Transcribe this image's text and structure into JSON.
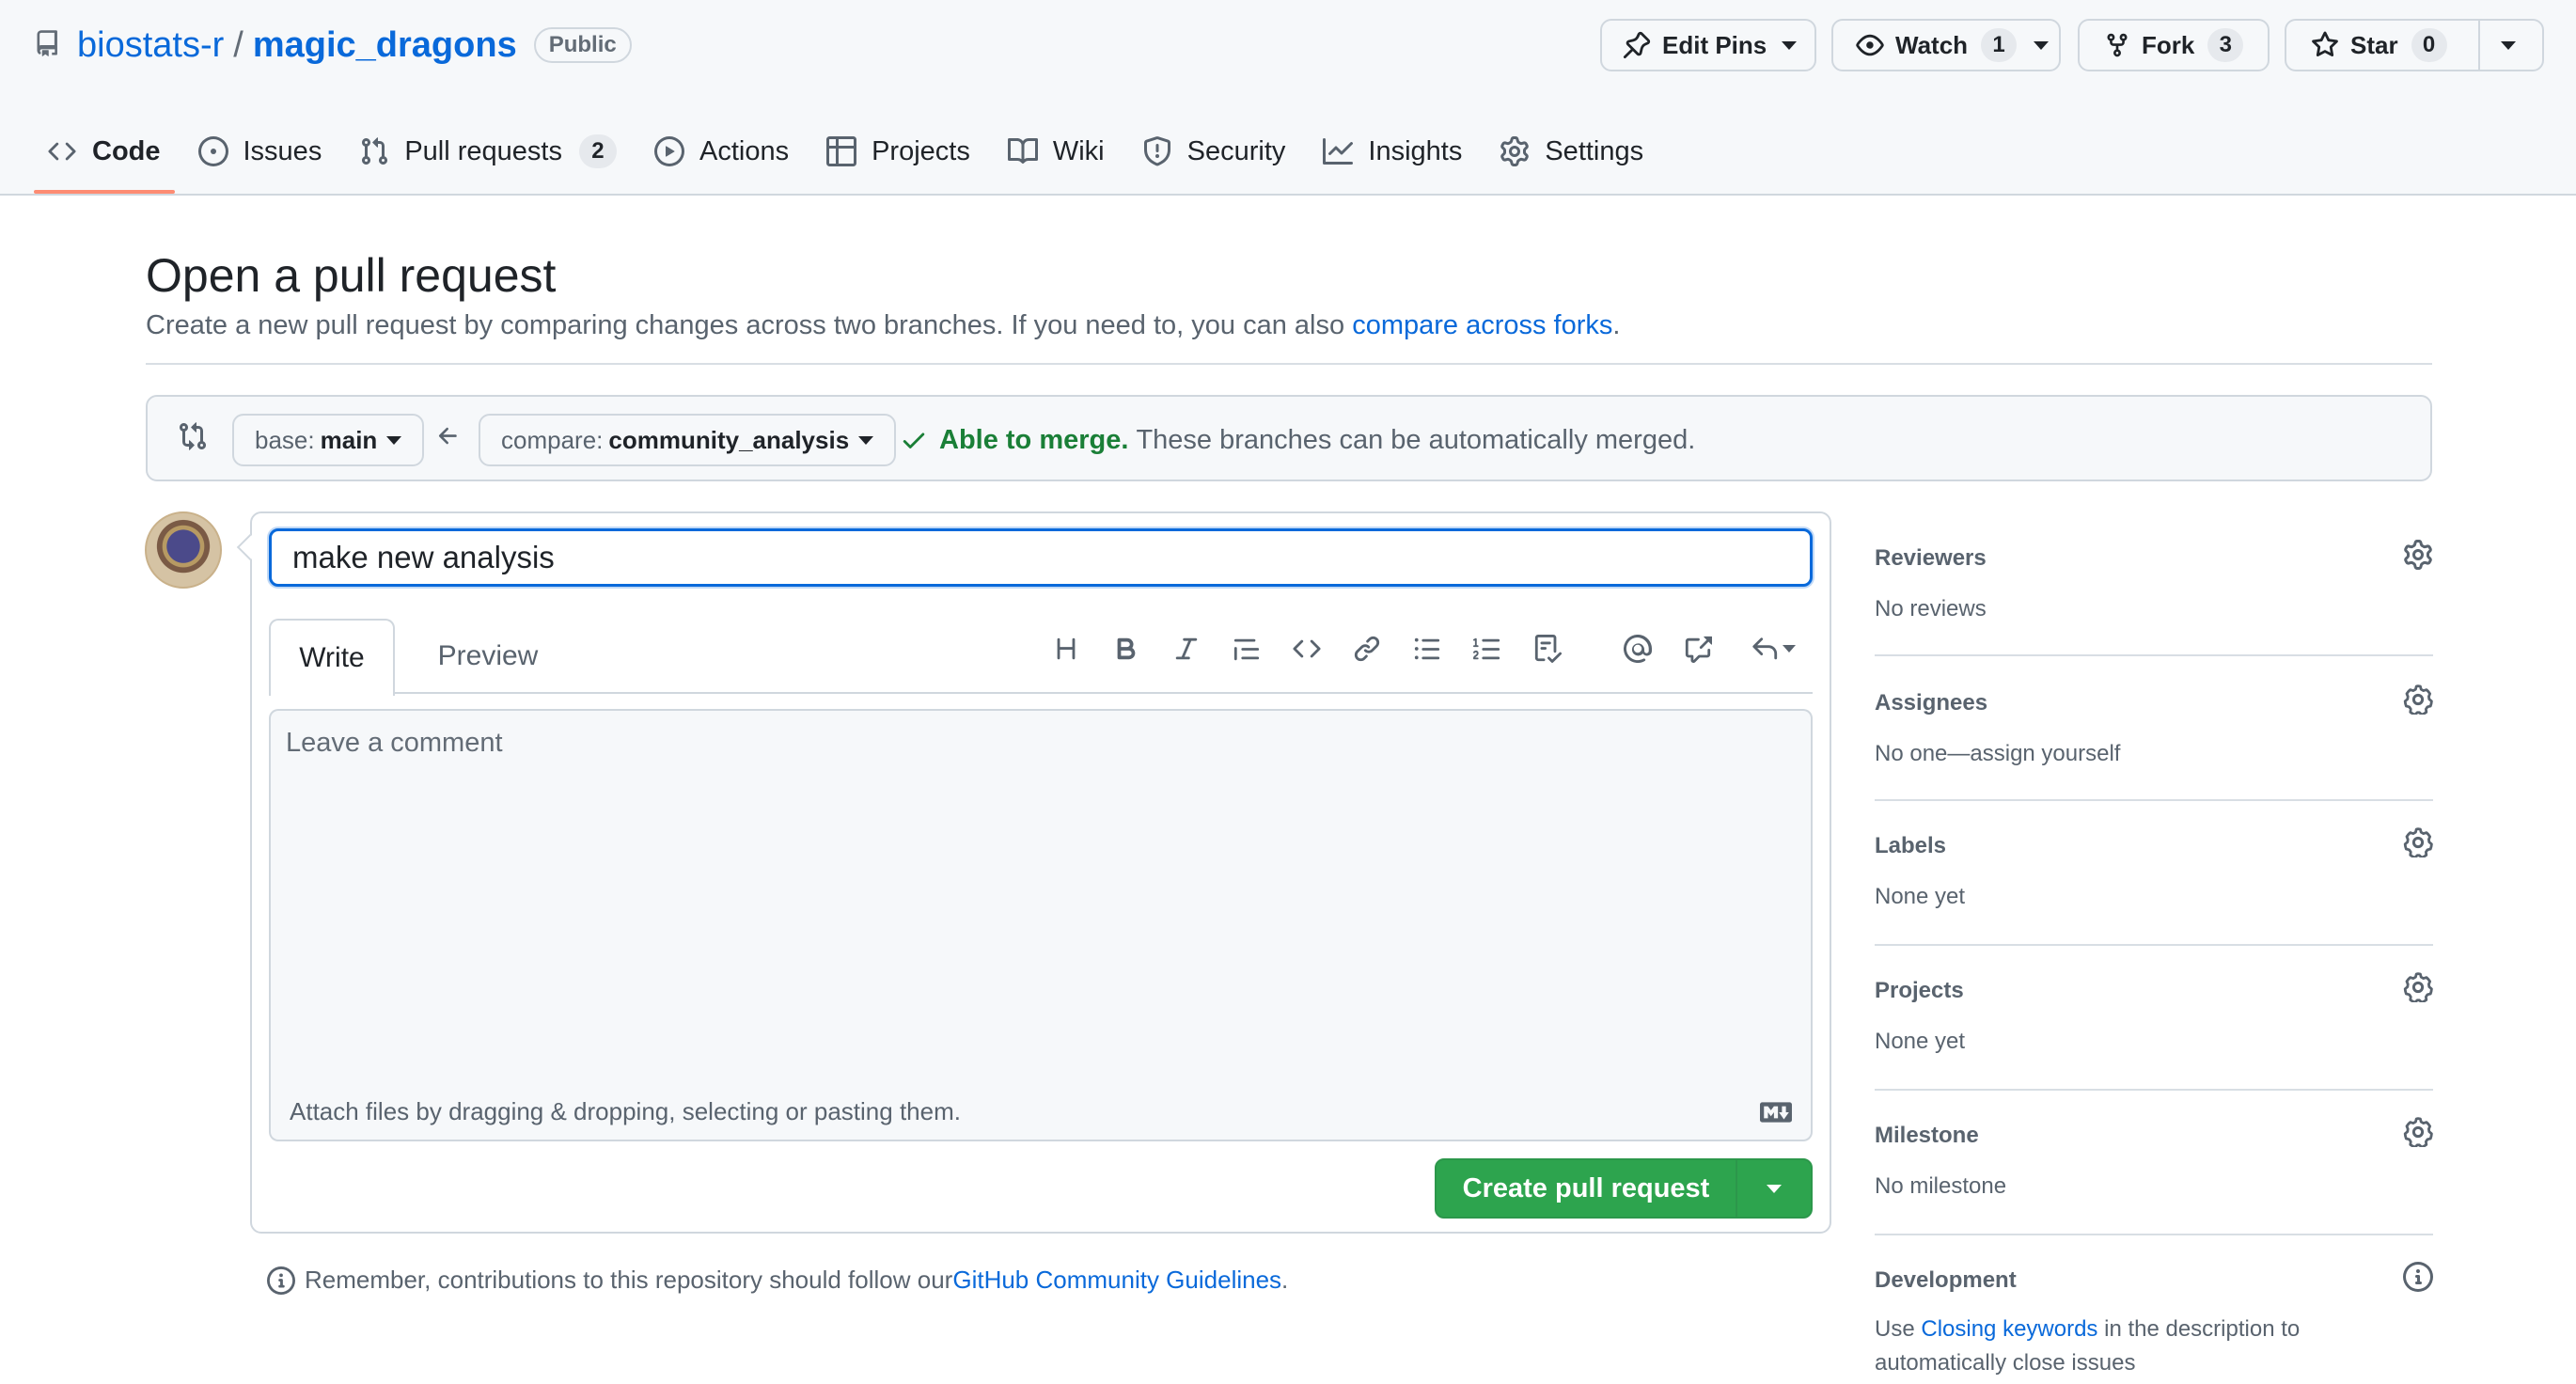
{
  "repo": {
    "owner": "biostats-r",
    "separator": "/",
    "name": "magic_dragons",
    "visibility": "Public"
  },
  "header_buttons": {
    "edit_pins": "Edit Pins",
    "watch": "Watch",
    "watch_count": "1",
    "fork": "Fork",
    "fork_count": "3",
    "star": "Star",
    "star_count": "0"
  },
  "nav": {
    "code": "Code",
    "issues": "Issues",
    "pull_requests": "Pull requests",
    "pull_requests_count": "2",
    "actions": "Actions",
    "projects": "Projects",
    "wiki": "Wiki",
    "security": "Security",
    "insights": "Insights",
    "settings": "Settings"
  },
  "page": {
    "title": "Open a pull request",
    "subtitle": "Create a new pull request by comparing changes across two branches. If you need to, you can also ",
    "subtitle_link": "compare across forks",
    "subtitle_end": "."
  },
  "compare": {
    "base_label": "base:",
    "base_branch": "main",
    "compare_label": "compare:",
    "compare_branch": "community_analysis",
    "merge_ok": "Able to merge.",
    "merge_msg": "These branches can be automatically merged."
  },
  "form": {
    "title_value": "make new analysis",
    "tab_write": "Write",
    "tab_preview": "Preview",
    "comment_placeholder": "Leave a comment",
    "attach_hint": "Attach files by dragging & dropping, selecting or pasting them.",
    "submit_label": "Create pull request"
  },
  "guidelines": {
    "text": "Remember, contributions to this repository should follow our ",
    "link": "GitHub Community Guidelines",
    "end": "."
  },
  "sidebar": {
    "reviewers": {
      "title": "Reviewers",
      "value": "No reviews"
    },
    "assignees": {
      "title": "Assignees",
      "value": "No one—assign yourself"
    },
    "labels": {
      "title": "Labels",
      "value": "None yet"
    },
    "projects": {
      "title": "Projects",
      "value": "None yet"
    },
    "milestone": {
      "title": "Milestone",
      "value": "No milestone"
    },
    "development": {
      "title": "Development",
      "value_pre": "Use ",
      "value_link": "Closing keywords",
      "value_post": " in the description to automatically close issues"
    }
  },
  "colors": {
    "accent": "#0969da",
    "success": "#1a7f37",
    "primary_button": "#2da44e",
    "tab_underline": "#fd8c73"
  }
}
